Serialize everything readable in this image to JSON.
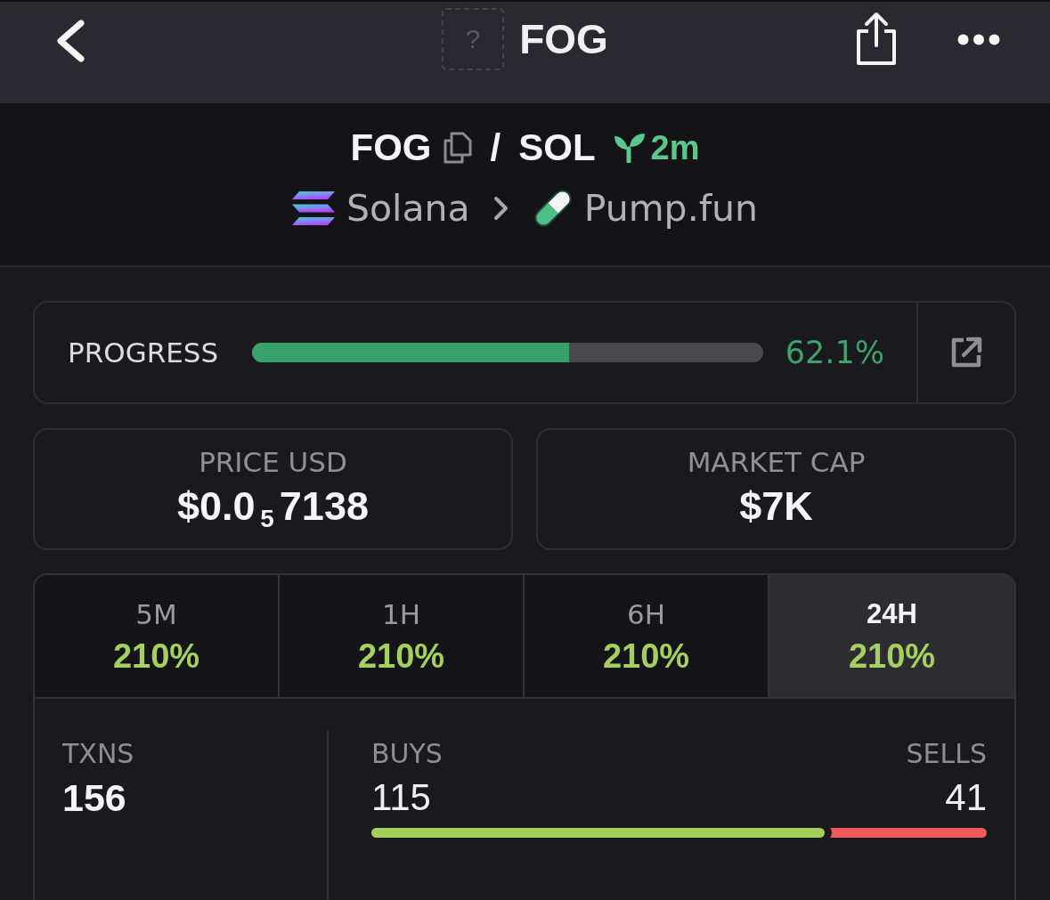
{
  "top_bar": {
    "logo_placeholder": "?",
    "title": "FOG"
  },
  "pair": {
    "base": "FOG",
    "separator": "/",
    "quote": "SOL",
    "age": "2m",
    "chain": "Solana",
    "dex": "Pump.fun"
  },
  "progress": {
    "label": "PROGRESS",
    "level": 0.621,
    "reading": "62.1%"
  },
  "summary_cards": [
    {
      "label": "PRICE USD",
      "value": "$0.0$_{5}$7138"
    },
    {
      "label": "MARKET CAP",
      "value": "$7K"
    }
  ],
  "timeframes": [
    {
      "label": "5M",
      "change": "210%",
      "selected": false
    },
    {
      "label": "1H",
      "change": "210%",
      "selected": false
    },
    {
      "label": "6H",
      "change": "210%",
      "selected": false
    },
    {
      "label": "24H",
      "change": "210%",
      "selected": true
    }
  ],
  "transactions": {
    "total_label": "TXNS",
    "total": "156",
    "buys_label": "BUYS",
    "buys": "115",
    "sells_label": "SELLS",
    "sells": "41",
    "buy_share": {
      "level": 0.737
    }
  }
}
